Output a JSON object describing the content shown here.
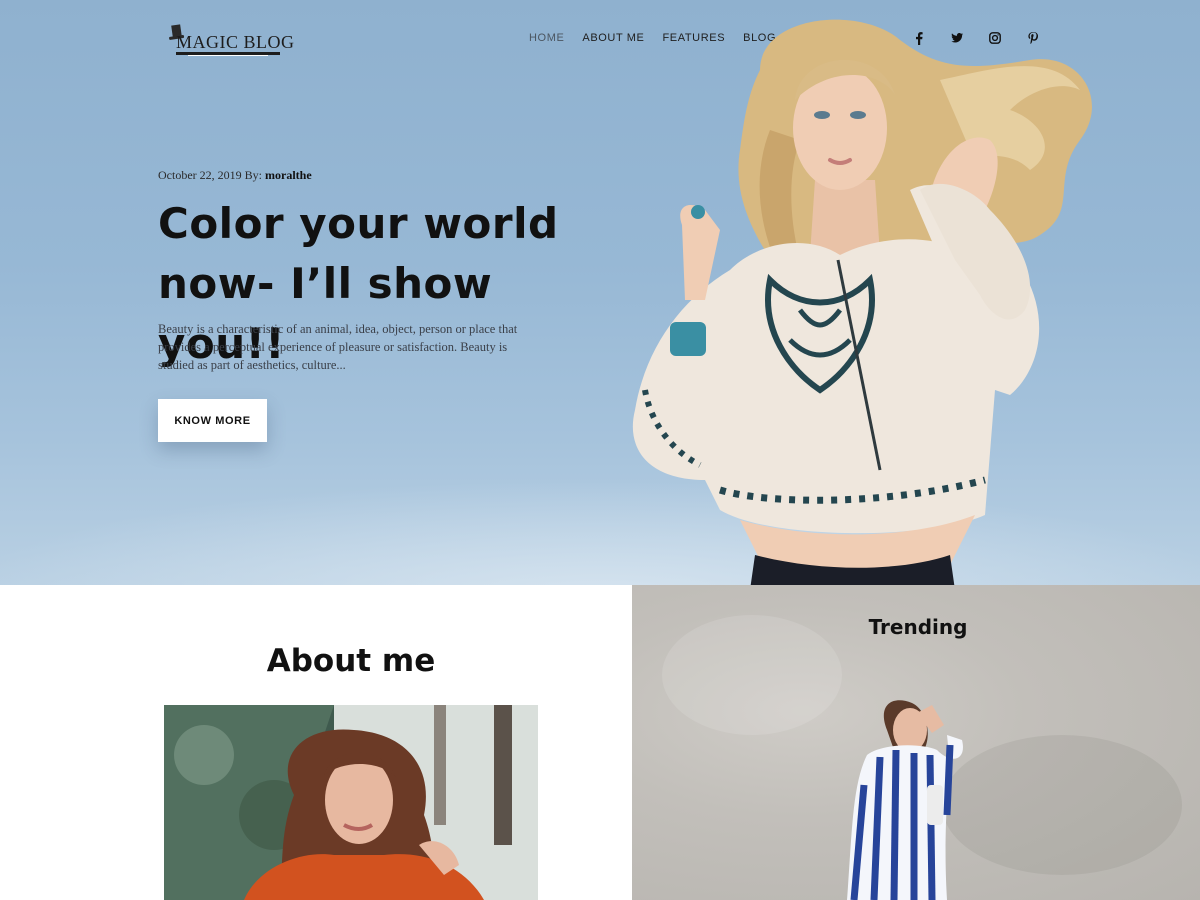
{
  "header": {
    "logo_text": "MAGIC BLOG",
    "nav": [
      {
        "label": "HOME",
        "active": true
      },
      {
        "label": "ABOUT ME",
        "active": false
      },
      {
        "label": "FEATURES",
        "active": false
      },
      {
        "label": "BLOG",
        "active": false
      }
    ],
    "search_icon": "search-icon",
    "social": [
      "facebook-icon",
      "twitter-icon",
      "instagram-icon",
      "pinterest-icon"
    ]
  },
  "hero": {
    "date": "October 22, 2019",
    "by": "By:",
    "author": "moralthe",
    "title_line1": "Color your world",
    "title_line2": "now- I’ll show you!!",
    "excerpt": "Beauty is a characteristic of an animal, idea, object, person or place that provides a perceptual experience of pleasure or satisfaction. Beauty is studied as part of aesthetics, culture...",
    "button_label": "KNOW MORE"
  },
  "about": {
    "title": "About me"
  },
  "trending": {
    "title": "Trending"
  },
  "colors": {
    "hero_sky": "#97b8d5",
    "text_dark": "#111111",
    "button_bg": "#ffffff"
  }
}
